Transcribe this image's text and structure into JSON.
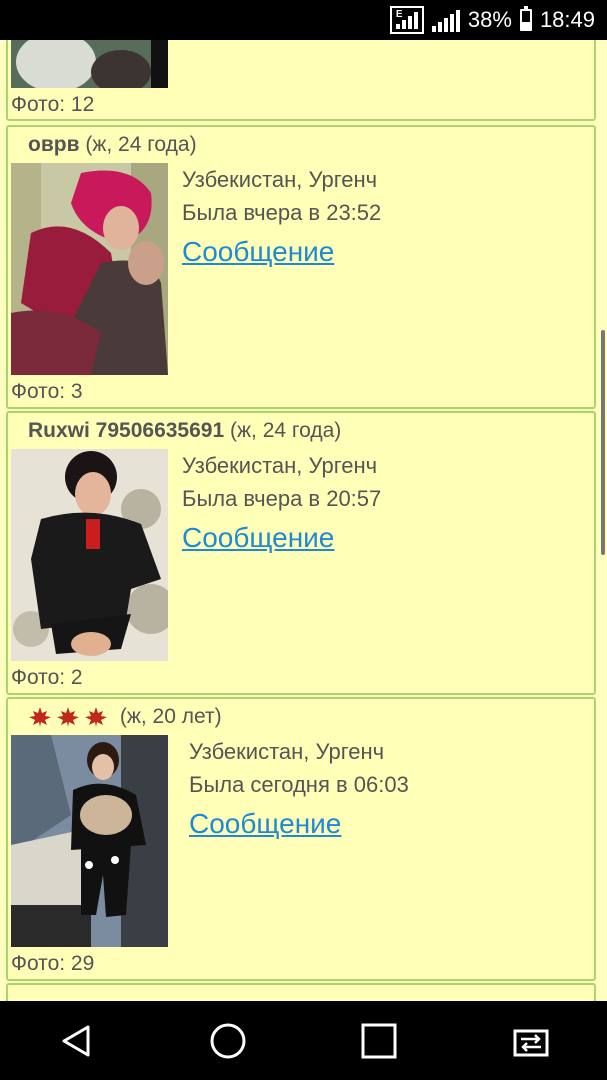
{
  "status_bar": {
    "battery": "38%",
    "time": "18:49",
    "sim_label": "E"
  },
  "top_card": {
    "foto": "Фото: 12"
  },
  "profiles": [
    {
      "name": "оврв",
      "meta": "(ж, 24 года)",
      "location": "Узбекистан, Ургенч",
      "last_seen": "Была вчера в 23:52",
      "message": "Сообщение",
      "foto": "Фото: 3"
    },
    {
      "name": "Ruxwi 79506635691",
      "meta": "(ж, 24 года)",
      "location": "Узбекистан, Ургенч",
      "last_seen": "Была вчера в 20:57",
      "message": "Сообщение",
      "foto": "Фото: 2"
    },
    {
      "name": "",
      "meta": "(ж, 20 лет)",
      "location": "Узбекистан, Ургенч",
      "last_seen": "Была сегодня в 06:03",
      "message": "Сообщение",
      "foto": "Фото: 29",
      "star_icons": [
        "maple-leaf-icon",
        "maple-leaf-icon",
        "maple-leaf-icon"
      ],
      "star_color": "#c0281c"
    }
  ],
  "colors": {
    "page_bg": "#ffffc0",
    "card_border": "#a9d66a",
    "link": "#1e8ad6",
    "text": "#555555"
  },
  "nav": {
    "icons": [
      "back-icon",
      "home-icon",
      "recents-icon",
      "screen-switch-icon"
    ]
  }
}
